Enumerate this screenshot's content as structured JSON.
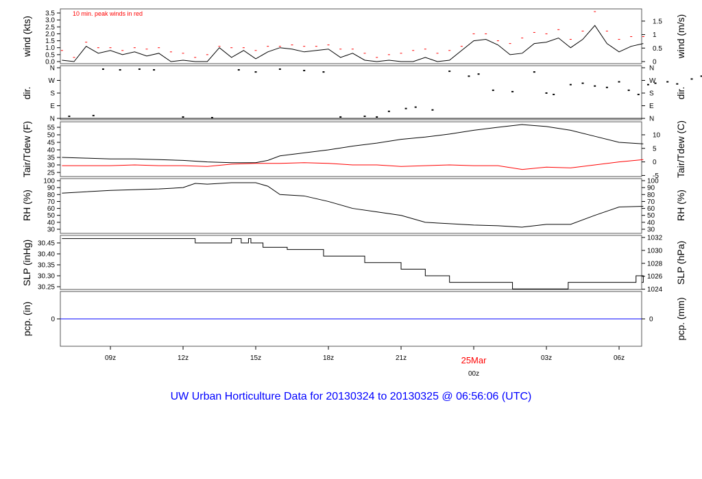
{
  "title": "UW Urban Horticulture Data for 20130324  to  20130325 @ 06:56:06  (UTC)",
  "note": "10 min. peak winds in red",
  "date_label": "25Mar",
  "colors": {
    "peak": "#ff0000",
    "dew": "#ff0000",
    "pcp": "#0000ff",
    "title": "#0000ff",
    "line": "#000000"
  },
  "chart_data": [
    {
      "type": "line",
      "name": "wind",
      "ylabel": "wind (kts)",
      "ylabel_right": "wind (m/s)",
      "ylim": [
        0,
        3.6
      ],
      "yticks": [
        "0.0",
        "0.5",
        "1.0",
        "1.5",
        "2.0",
        "2.5",
        "3.0",
        "3.5"
      ],
      "yticks_right": [
        "0",
        "0.5",
        "1",
        "1.5"
      ],
      "x_hours": [
        0,
        0.5,
        1,
        1.5,
        2,
        2.5,
        3,
        3.5,
        4,
        4.5,
        5,
        5.5,
        6,
        6.5,
        7,
        7.5,
        8,
        8.5,
        9,
        9.5,
        10,
        10.5,
        11,
        11.5,
        12,
        12.5,
        13,
        13.5,
        14,
        14.5,
        15,
        15.5,
        16,
        16.5,
        17,
        17.5,
        18,
        18.5,
        19,
        19.5,
        20,
        20.5,
        21,
        21.5,
        22,
        22.5,
        23,
        23.5,
        24
      ],
      "speed": [
        0.1,
        0,
        1.1,
        0.6,
        0.8,
        0.5,
        0.7,
        0.4,
        0.6,
        0,
        0.1,
        0,
        0,
        1.0,
        0.3,
        0.8,
        0.2,
        0.7,
        1.0,
        0.9,
        0.7,
        0.8,
        0.9,
        0.3,
        0.6,
        0.1,
        0,
        0.1,
        0,
        0,
        0.3,
        0,
        0.1,
        0.8,
        1.5,
        1.6,
        1.2,
        0.5,
        0.6,
        1.3,
        1.4,
        1.7,
        1.0,
        1.6,
        2.6,
        1.3,
        0.7,
        1.1,
        1.3,
        0.8,
        0.3,
        0,
        0.3,
        0.1
      ],
      "peak": [
        0.8,
        0.3,
        1.4,
        1.0,
        1.0,
        0.8,
        1.0,
        0.9,
        1.0,
        0.7,
        0.6,
        0.3,
        0.5,
        1.1,
        1.0,
        1.0,
        0.8,
        1.1,
        1.1,
        1.2,
        1.1,
        1.1,
        1.2,
        0.9,
        0.9,
        0.6,
        0.3,
        0.5,
        0.6,
        0.8,
        0.9,
        0.6,
        0.8,
        1.1,
        2.0,
        2.0,
        1.5,
        1.3,
        1.7,
        2.1,
        2.0,
        2.3,
        1.6,
        2.2,
        3.6,
        2.2,
        1.6,
        1.8,
        1.8,
        1.3,
        0.8,
        0.5,
        0.7,
        0.4
      ]
    },
    {
      "type": "scatter",
      "name": "direction",
      "ylabel": "dir.",
      "yticks": [
        "N",
        "E",
        "S",
        "W",
        "N"
      ],
      "ylim": [
        0,
        360
      ],
      "x_hours": [
        0.3,
        1.3,
        1.7,
        2.4,
        3.2,
        3.8,
        5,
        6.2,
        7.3,
        8,
        9,
        10,
        10.8,
        11.5,
        12.5,
        13,
        13.5,
        14.2,
        14.6,
        15.3,
        16,
        16.8,
        17.2,
        17.8,
        18.6,
        19.5,
        20,
        20.3,
        21,
        21.5,
        22,
        22.5,
        23,
        23.4,
        23.8,
        24.2,
        24.5,
        25,
        25.4,
        26,
        26.4,
        26.7,
        27.2,
        27.8,
        28.5,
        29.5,
        30.5,
        30.9
      ],
      "deg": [
        15,
        20,
        350,
        345,
        350,
        345,
        10,
        5,
        345,
        330,
        350,
        340,
        330,
        10,
        15,
        10,
        50,
        70,
        80,
        60,
        335,
        300,
        315,
        200,
        190,
        330,
        180,
        170,
        240,
        250,
        230,
        220,
        260,
        200,
        170,
        240,
        250,
        260,
        245,
        280,
        300,
        320,
        310,
        330,
        15,
        10,
        20,
        270
      ]
    },
    {
      "type": "line",
      "name": "temperature",
      "ylabel": "Tair/Tdew (F)",
      "ylabel_right": "Tair/Tdew (C)",
      "ylim": [
        22,
        58
      ],
      "yticks": [
        "25",
        "30",
        "35",
        "40",
        "45",
        "50",
        "55"
      ],
      "yticks_right": [
        "-5",
        "0",
        "5",
        "10"
      ],
      "x_hours": [
        0,
        1,
        2,
        3,
        4,
        5,
        6,
        7,
        8,
        8.5,
        9,
        10,
        11,
        12,
        13,
        14,
        15,
        16,
        17,
        18,
        19,
        20,
        21,
        22,
        23,
        24
      ],
      "tair": [
        35,
        34.5,
        34,
        34,
        33.5,
        33,
        32,
        31.5,
        31.5,
        33,
        36,
        38,
        40,
        42.5,
        44.5,
        47,
        48.5,
        50.5,
        53,
        55,
        56.8,
        55.5,
        53,
        49,
        45,
        44
      ],
      "tdew": [
        29.5,
        29.5,
        29.5,
        30,
        29.5,
        29.5,
        29,
        30.5,
        31,
        31,
        31,
        31.5,
        31,
        30,
        30,
        29,
        29.5,
        30,
        29.5,
        29.5,
        27,
        28.5,
        28,
        30,
        32,
        33.5
      ]
    },
    {
      "type": "line",
      "name": "rh",
      "ylabel": "RH (%)",
      "ylim": [
        27,
        102
      ],
      "yticks": [
        "30",
        "40",
        "50",
        "60",
        "70",
        "80",
        "90",
        "100"
      ],
      "x_hours": [
        0,
        2,
        4,
        5,
        5.5,
        6,
        7,
        8,
        8.5,
        9,
        10,
        11,
        12,
        13,
        14,
        15,
        16,
        17,
        18,
        19,
        20,
        21,
        22,
        23,
        24
      ],
      "rh": [
        82,
        86,
        88,
        90,
        96,
        95,
        97,
        97,
        92,
        80,
        78,
        70,
        60,
        55,
        50,
        40,
        38,
        36,
        35,
        33,
        37,
        37,
        50,
        62,
        63
      ]
    },
    {
      "type": "step",
      "name": "slp",
      "ylabel": "SLP (inHg)",
      "ylabel_right": "SLP (hPa)",
      "ylim": [
        30.235,
        30.48
      ],
      "yticks": [
        "30.25",
        "30.30",
        "30.35",
        "30.40",
        "30.45"
      ],
      "yticks_right": [
        "1024",
        "1026",
        "1028",
        "1030",
        "1032"
      ],
      "x_hours": [
        0,
        5.5,
        7,
        7.4,
        7.7,
        7.8,
        8.0,
        8.3,
        9.2,
        9.3,
        10.8,
        12.5,
        14,
        15,
        16,
        17,
        18.6,
        18.7,
        20.9,
        23.7,
        24
      ],
      "slp": [
        30.47,
        30.45,
        30.47,
        30.45,
        30.47,
        30.45,
        30.45,
        30.43,
        30.43,
        30.42,
        30.39,
        30.36,
        30.33,
        30.3,
        30.27,
        30.27,
        30.24,
        30.24,
        30.27,
        30.3,
        30.27
      ]
    },
    {
      "type": "line",
      "name": "precip",
      "ylabel": "pcp. (in)",
      "ylabel_right": "pcp. (mm)",
      "yticks": [
        "0"
      ],
      "yticks_right": [
        "0"
      ],
      "value": 0
    },
    {
      "xticks": [
        "09z",
        "12z",
        "15z",
        "18z",
        "21z",
        "00z",
        "03z",
        "06z"
      ]
    }
  ]
}
